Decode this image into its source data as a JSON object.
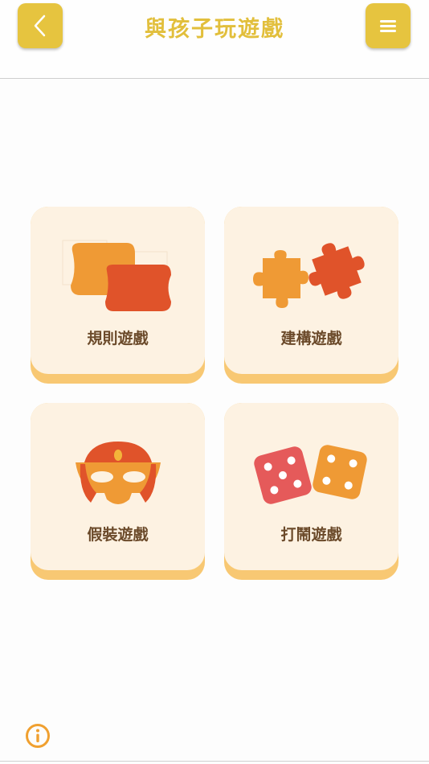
{
  "header": {
    "title": "與孩子玩遊戲",
    "back_icon": "chevron-left-icon",
    "menu_icon": "hamburger-menu-icon"
  },
  "cards": [
    {
      "label": "規則遊戲",
      "icon": "cards-icon"
    },
    {
      "label": "建構遊戲",
      "icon": "puzzle-icon"
    },
    {
      "label": "假裝遊戲",
      "icon": "mask-icon"
    },
    {
      "label": "打鬧遊戲",
      "icon": "dice-icon"
    }
  ],
  "footer": {
    "info_icon": "info-icon"
  },
  "colors": {
    "accent": "#e6c43f",
    "card_face": "#fdf2e2",
    "card_edge": "#f8c873",
    "label": "#6b4a2a",
    "orange": "#ef9a35",
    "red_orange": "#e0532a"
  }
}
